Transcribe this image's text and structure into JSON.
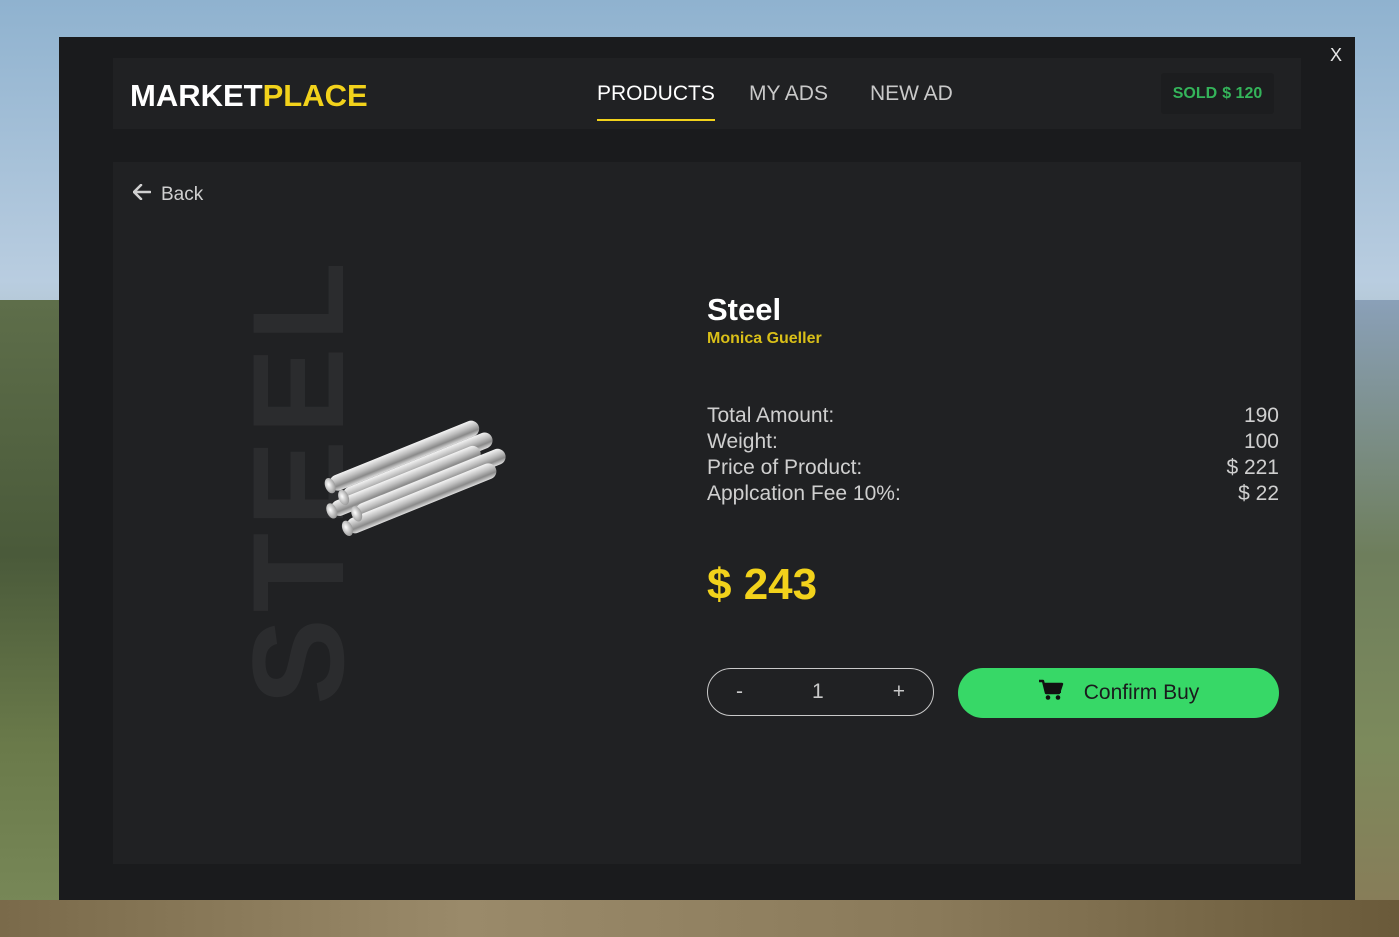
{
  "window": {
    "close_label": "X"
  },
  "header": {
    "logo_part1": "MARKET",
    "logo_part2": "PLACE",
    "tabs": [
      {
        "label": "PRODUCTS",
        "active": true
      },
      {
        "label": "MY ADS",
        "active": false
      },
      {
        "label": "NEW AD",
        "active": false
      }
    ],
    "sold_label": "SOLD",
    "sold_amount": "$ 120"
  },
  "product": {
    "back_label": "Back",
    "watermark": "STEEL",
    "name": "Steel",
    "seller": "Monica Gueller",
    "details": [
      {
        "label": "Total Amount:",
        "value": "190"
      },
      {
        "label": "Weight:",
        "value": "100"
      },
      {
        "label": "Price of Product:",
        "value": "$ 221"
      },
      {
        "label": "Applcation Fee 10%:",
        "value": "$ 22"
      }
    ],
    "total": "$ 243",
    "quantity": "1",
    "minus_label": "-",
    "plus_label": "+",
    "confirm_label": "Confirm Buy"
  },
  "colors": {
    "accent_yellow": "#f2d21b",
    "buy_green": "#37d867",
    "sold_green": "#34b45a",
    "panel_bg": "#202123"
  },
  "icons": [
    "arrow-left-icon",
    "cart-icon",
    "steel-bars-image"
  ]
}
